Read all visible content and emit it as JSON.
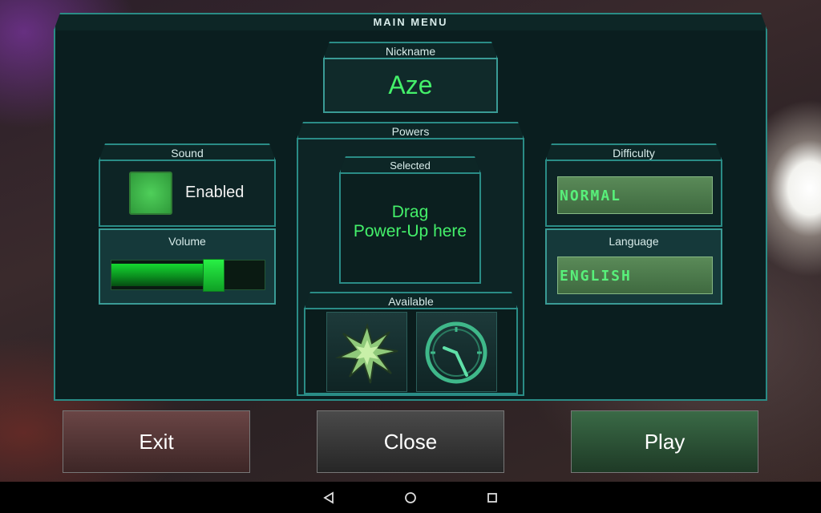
{
  "menu": {
    "title": "MAIN MENU"
  },
  "nickname": {
    "label": "Nickname",
    "value": "Aze"
  },
  "sound": {
    "label": "Sound",
    "toggle_label": "Enabled",
    "enabled": true
  },
  "volume": {
    "label": "Volume",
    "level": 0.57
  },
  "powers": {
    "label": "Powers",
    "selected_label": "Selected",
    "drop_line1": "Drag",
    "drop_line2": "Power-Up here",
    "available_label": "Available",
    "items": [
      {
        "icon": "explosion-icon"
      },
      {
        "icon": "clock-icon"
      }
    ]
  },
  "difficulty": {
    "label": "Difficulty",
    "value": "NORMAL"
  },
  "language": {
    "label": "Language",
    "value": "ENGLISH"
  },
  "buttons": {
    "exit": "Exit",
    "close": "Close",
    "play": "Play"
  },
  "colors": {
    "accent": "#2a8c86",
    "text_green": "#44f06a",
    "exit": "#5a3a3a",
    "close": "#3e3e3e",
    "play": "#2f5a38"
  },
  "navbar": {
    "icons": [
      "back-icon",
      "home-icon",
      "recents-icon"
    ]
  }
}
